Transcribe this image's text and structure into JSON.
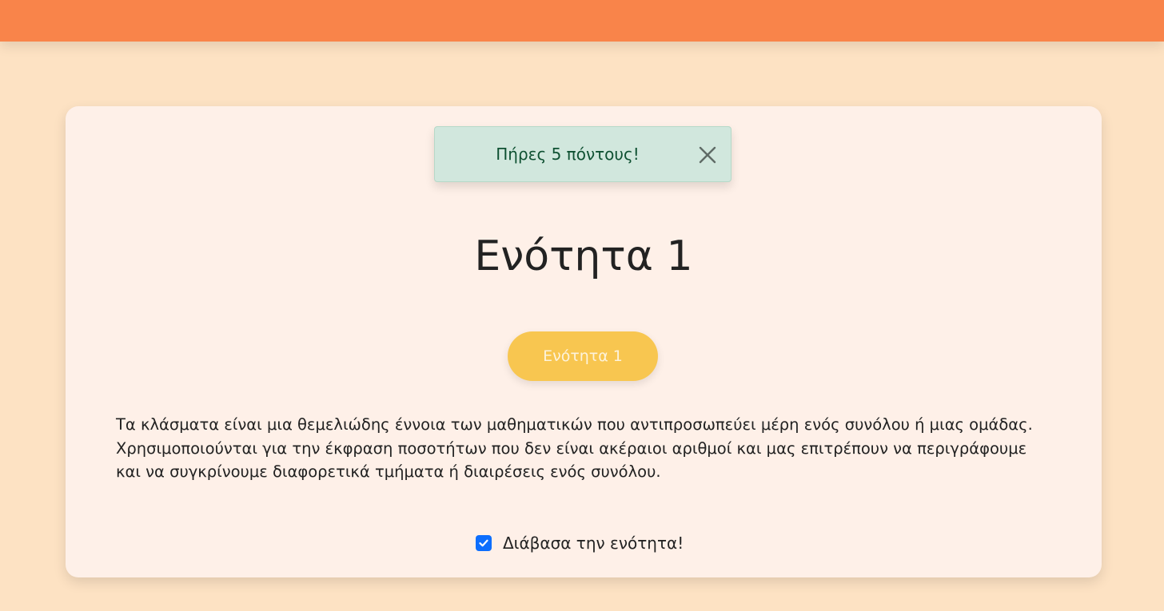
{
  "header": {
    "color": "#f9844a"
  },
  "toast": {
    "message": "Πήρες 5 πόντους!",
    "close_icon": "close-icon"
  },
  "section": {
    "title": "Ενότητα 1",
    "button_label": "Ενότητα 1",
    "paragraph": "Τα κλάσματα είναι μια θεμελιώδης έννοια των μαθηματικών που αντιπροσωπεύει μέρη ενός συνόλου ή μιας ομάδας. Χρησιμοποιούνται για την έκφραση ποσοτήτων που δεν είναι ακέραιοι αριθμοί και μας επιτρέπουν να περιγράφουμε και να συγκρίνουμε διαφορετικά τμήματα ή διαιρέσεις ενός συνόλου."
  },
  "read_check": {
    "label": "Διάβασα την ενότητα!",
    "checked": true
  },
  "colors": {
    "background": "#fde2c3",
    "card": "#fef0e8",
    "button": "#f8c650",
    "toast_bg": "#d1e7dd",
    "checkbox": "#0d6efd"
  }
}
